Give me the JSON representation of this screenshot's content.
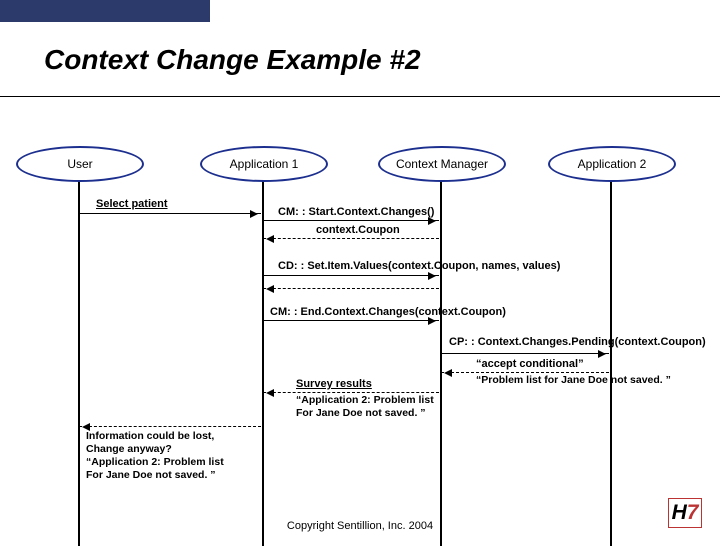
{
  "title": "Context Change Example #2",
  "actors": {
    "user": "User",
    "app1": "Application 1",
    "cm": "Context Manager",
    "app2": "Application 2"
  },
  "messages": {
    "select_patient": "Select patient",
    "start_ctx": "CM: : Start.Context.Changes()",
    "coupon_return": "context.Coupon",
    "set_values": "CD: : Set.Item.Values(context.Coupon, names, values)",
    "end_ctx": "CM: : End.Context.Changes(context.Coupon)",
    "pending": "CP: : Context.Changes.Pending(context.Coupon)",
    "accept_cond": "“accept conditional”",
    "survey_results": "Survey results",
    "survey_note": "“Application 2: Problem list\nFor Jane Doe not saved. ”",
    "app2_detail": "“Problem list for Jane Doe not saved. ”",
    "user_prompt": "Information could be lost,\nChange anyway?\n“Application 2: Problem list\nFor Jane Doe not saved. ”"
  },
  "footer": "Copyright Sentillion, Inc. 2004"
}
